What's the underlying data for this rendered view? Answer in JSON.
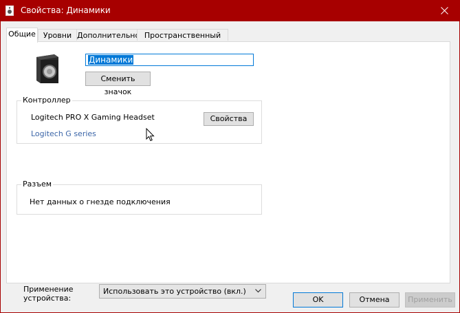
{
  "window": {
    "title": "Свойства: Динамики"
  },
  "tabs": [
    {
      "label": "Общие",
      "active": true
    },
    {
      "label": "Уровни",
      "active": false
    },
    {
      "label": "Дополнительно",
      "active": false
    },
    {
      "label": "Пространственный звук",
      "active": false
    }
  ],
  "device": {
    "name_value": "Динамики",
    "change_icon_label": "Сменить значок"
  },
  "controller": {
    "group_label": "Контроллер",
    "name": "Logitech PRO X Gaming Headset",
    "link": "Logitech G series",
    "properties_label": "Свойства"
  },
  "jack": {
    "group_label": "Разъем",
    "text": "Нет данных о гнезде подключения"
  },
  "usage": {
    "label_line1": "Применение",
    "label_line2": "устройства:",
    "selected": "Использовать это устройство (вкл.)"
  },
  "footer": {
    "ok_label": "OK",
    "cancel_label": "Отмена",
    "apply_label": "Применить"
  },
  "colors": {
    "titlebar": "#a70000",
    "link": "#3c66a8",
    "selection": "#0078d7"
  }
}
